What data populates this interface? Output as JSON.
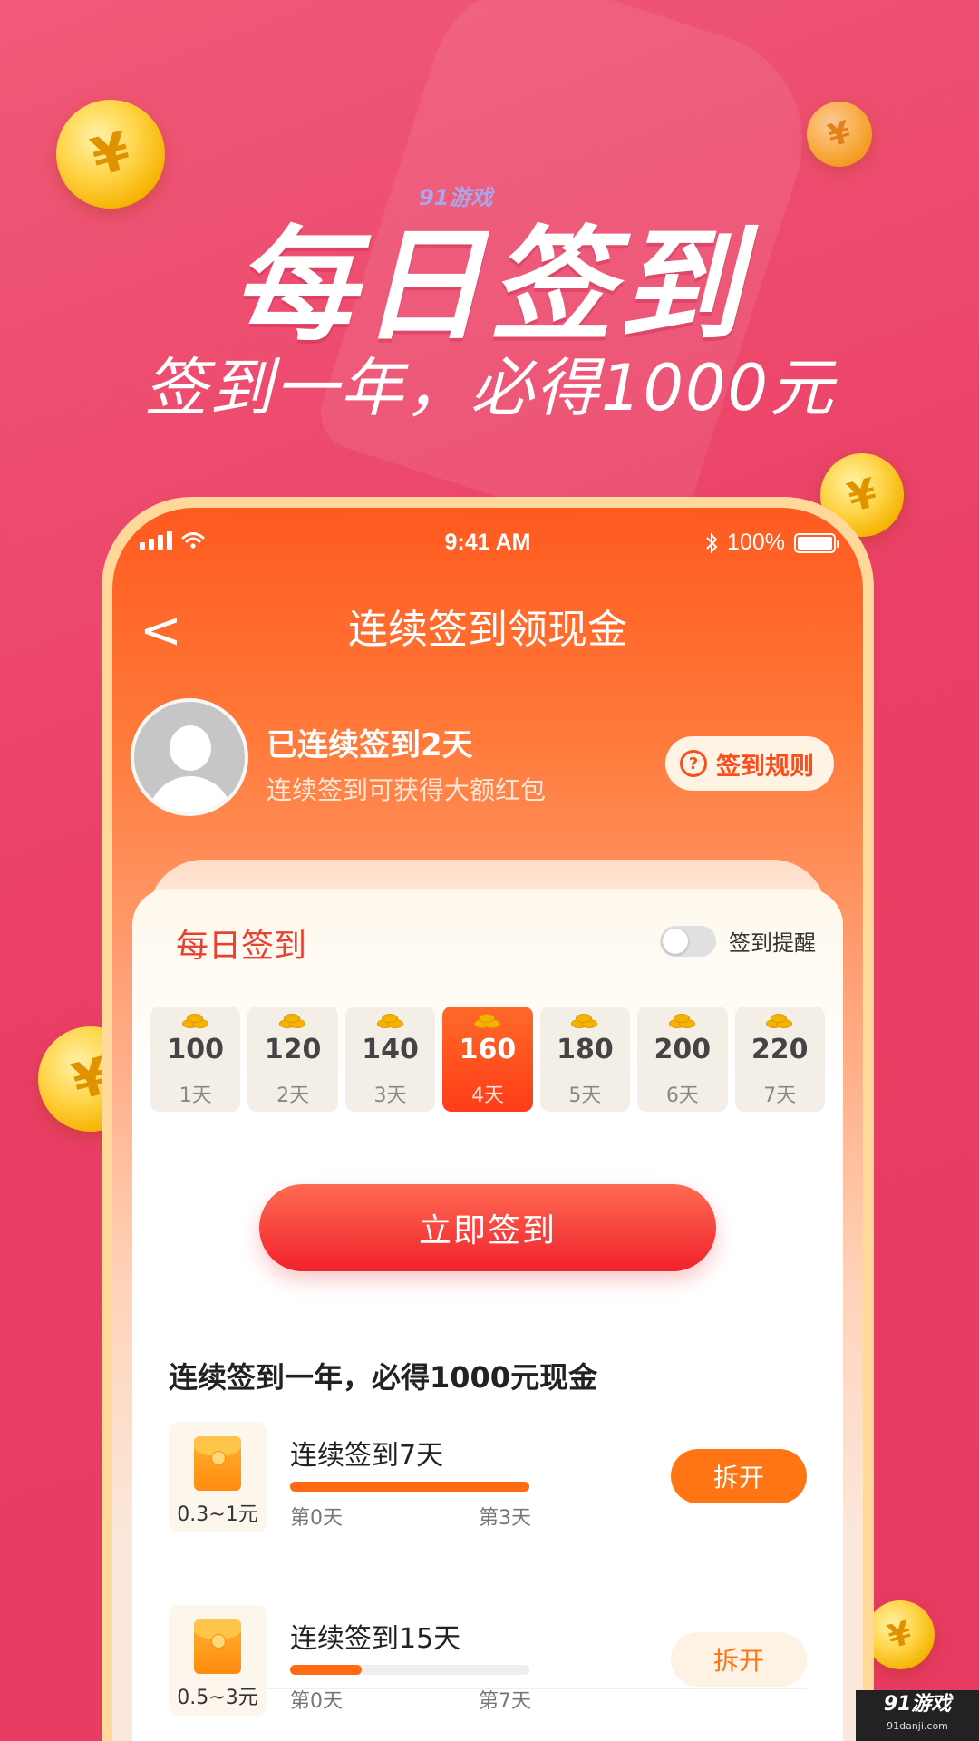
{
  "hero": {
    "title": "每日签到",
    "subtitle": "签到一年，必得1000元",
    "watermark": "91游戏"
  },
  "status_bar": {
    "time": "9:41 AM",
    "battery": "100%"
  },
  "nav": {
    "back": "<",
    "title": "连续签到领现金"
  },
  "user": {
    "title": "已连续签到2天",
    "subtitle": "连续签到可获得大额红包",
    "rules_icon": "?",
    "rules_label": "签到规则"
  },
  "checkin": {
    "title": "每日签到",
    "reminder_label": "签到提醒",
    "reminder_on": false,
    "days": [
      {
        "value": "100",
        "label": "1天"
      },
      {
        "value": "120",
        "label": "2天"
      },
      {
        "value": "140",
        "label": "3天"
      },
      {
        "value": "160",
        "label": "4天"
      },
      {
        "value": "180",
        "label": "5天"
      },
      {
        "value": "200",
        "label": "6天"
      },
      {
        "value": "220",
        "label": "7天"
      }
    ],
    "active_day_index": 3,
    "button": "立即签到"
  },
  "rewards": {
    "title": "连续签到一年，必得1000元现金",
    "items": [
      {
        "amount": "0.3~1元",
        "name": "连续签到7天",
        "progress": 1.0,
        "from": "第0天",
        "to": "第3天",
        "button": "拆开"
      },
      {
        "amount": "0.5~3元",
        "name": "连续签到15天",
        "progress": 0.3,
        "from": "第0天",
        "to": "第7天",
        "button": "拆开"
      }
    ]
  },
  "corner_watermark": {
    "brand": "91游戏",
    "site": "91danji.com"
  },
  "colors": {
    "background": "#ea3f66",
    "accent": "#ff6a12",
    "button_red": "#f0222c"
  }
}
